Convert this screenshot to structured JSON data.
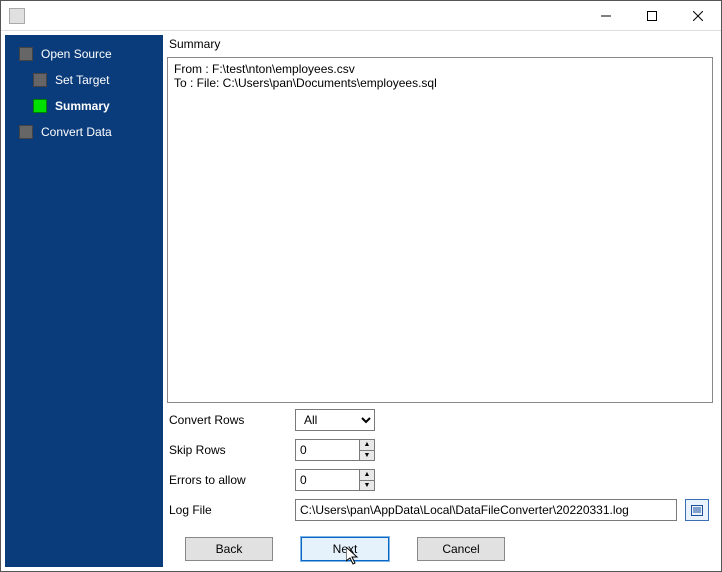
{
  "window": {
    "title": ""
  },
  "sidebar": {
    "items": [
      {
        "label": "Open Source",
        "indent": 0,
        "active": false
      },
      {
        "label": "Set Target",
        "indent": 1,
        "active": false
      },
      {
        "label": "Summary",
        "indent": 1,
        "active": true
      },
      {
        "label": "Convert Data",
        "indent": 0,
        "active": false
      }
    ]
  },
  "main": {
    "section_label": "Summary",
    "summary_text": "From : F:\\test\\nton\\employees.csv\nTo : File: C:\\Users\\pan\\Documents\\employees.sql",
    "convert_rows": {
      "label": "Convert Rows",
      "value": "All"
    },
    "skip_rows": {
      "label": "Skip Rows",
      "value": "0"
    },
    "errors_allow": {
      "label": "Errors to allow",
      "value": "0"
    },
    "log_file": {
      "label": "Log File",
      "value": "C:\\Users\\pan\\AppData\\Local\\DataFileConverter\\20220331.log"
    }
  },
  "buttons": {
    "back": "Back",
    "next": "Next",
    "cancel": "Cancel"
  }
}
